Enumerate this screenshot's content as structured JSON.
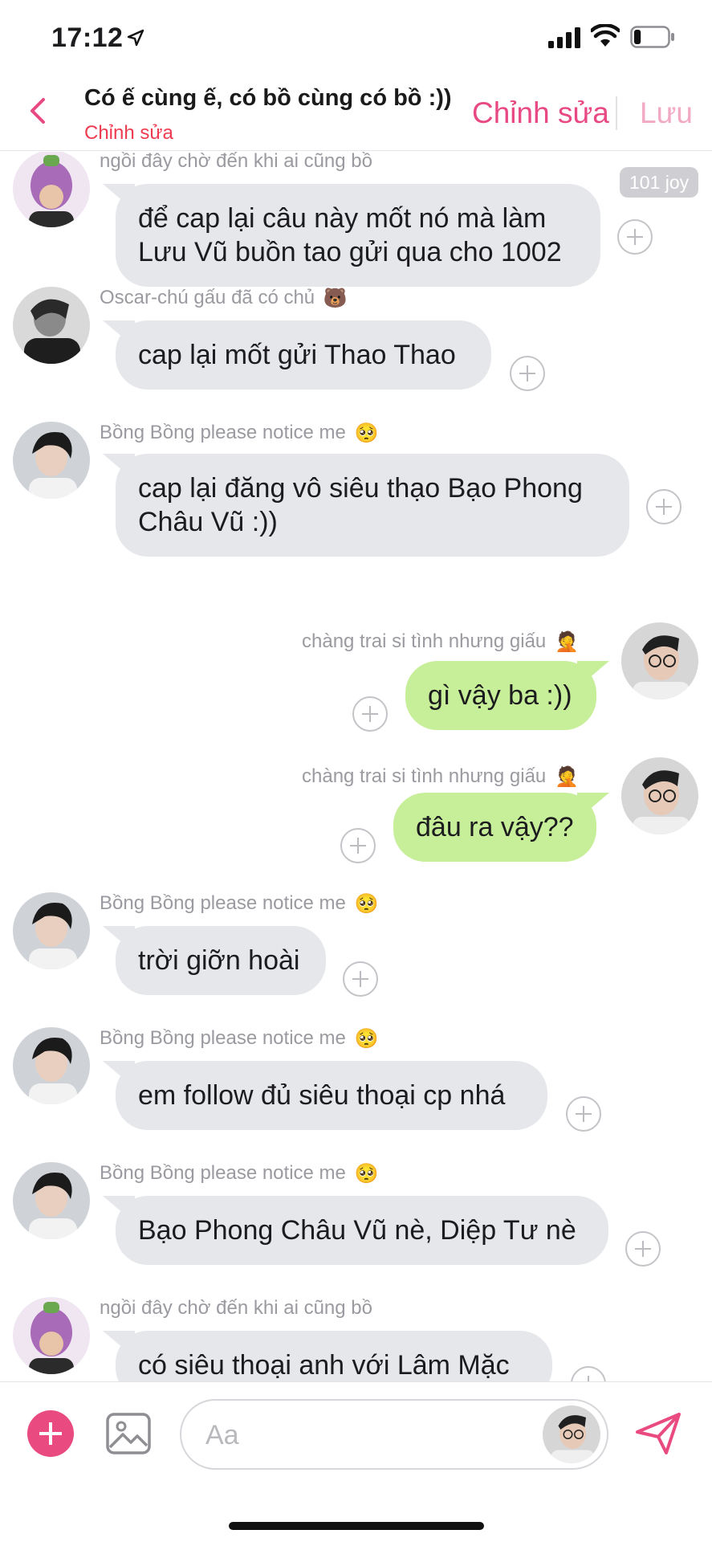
{
  "status_bar": {
    "time": "17:12",
    "icons": [
      "location-arrow-icon",
      "cellular-signal-icon",
      "wifi-icon",
      "battery-icon"
    ],
    "battery_level": 0.2
  },
  "header": {
    "title": "Có ế cùng ế, có bồ cùng có bồ :))",
    "subtitle": "Chỉnh sửa",
    "edit_label": "Chỉnh sửa",
    "save_label": "Lưu"
  },
  "colors": {
    "accent": "#e94983",
    "incoming_bubble": "#e6e7eb",
    "outgoing_bubble": "#c7ef9a",
    "subtitle_red": "#ee3b50"
  },
  "messages": [
    {
      "sender": "ngồi đây chờ đến khi ai cũng bồ",
      "text_lines": [
        "để cap lại câu này mốt nó mà làm",
        "Lưu Vũ buồn tao gửi qua cho 1002"
      ],
      "direction": "incoming",
      "avatar": "eggplant-hat-avatar",
      "badge": "101 joy"
    },
    {
      "sender": "Oscar-chú gấu đã có chủ",
      "sender_emoji": "🐻",
      "text_lines": [
        "cap lại mốt gửi Thao Thao"
      ],
      "direction": "incoming",
      "avatar": "bw-portrait-avatar"
    },
    {
      "sender": "Bồng Bồng please notice me",
      "sender_emoji": "🥺",
      "text_lines": [
        "cap lại đăng vô siêu thạo Bạo Phong",
        "Châu Vũ :))"
      ],
      "direction": "incoming",
      "avatar": "dark-hair-avatar"
    },
    {
      "sender": "chàng trai si tình nhưng giấu",
      "sender_emoji": "🤦",
      "text_lines": [
        "gì vậy ba :))"
      ],
      "direction": "outgoing",
      "avatar": "glasses-avatar"
    },
    {
      "sender": "chàng trai si tình nhưng giấu",
      "sender_emoji": "🤦",
      "text_lines": [
        "đâu ra vậy??"
      ],
      "direction": "outgoing",
      "avatar": "glasses-avatar"
    },
    {
      "sender": "Bồng Bồng please notice me",
      "sender_emoji": "🥺",
      "text_lines": [
        "trời giỡn hoài"
      ],
      "direction": "incoming",
      "avatar": "dark-hair-avatar"
    },
    {
      "sender": "Bồng Bồng please notice me",
      "sender_emoji": "🥺",
      "text_lines": [
        "em follow đủ siêu thoại cp nhá"
      ],
      "direction": "incoming",
      "avatar": "dark-hair-avatar"
    },
    {
      "sender": "Bồng Bồng please notice me",
      "sender_emoji": "🥺",
      "text_lines": [
        "Bạo Phong Châu Vũ nè, Diệp Tư nè"
      ],
      "direction": "incoming",
      "avatar": "dark-hair-avatar"
    },
    {
      "sender": "ngồi đây chờ đến khi ai cũng bồ",
      "text_lines": [
        "có siêu thoại anh với Lâm Mặc"
      ],
      "direction": "incoming",
      "avatar": "eggplant-hat-avatar"
    }
  ],
  "composer": {
    "placeholder": "Aa",
    "add_icon": "plus-icon",
    "image_icon": "image-icon",
    "send_icon": "send-icon"
  }
}
